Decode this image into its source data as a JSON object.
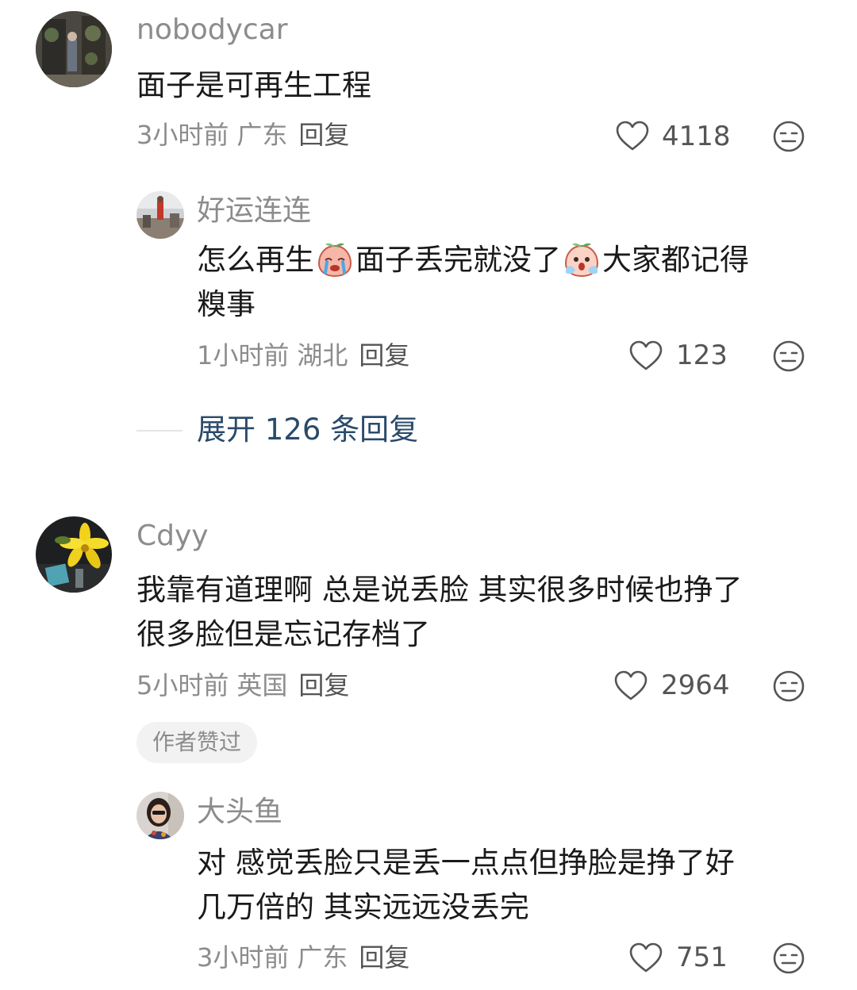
{
  "comments": [
    {
      "username": "nobodycar",
      "text": "面子是可再生工程",
      "time": "3小时前",
      "region": "广东",
      "reply_label": "回复",
      "likes": "4118",
      "replies": [
        {
          "username": "好运连连",
          "text_parts": [
            "怎么再生",
            "面子丢完就没了",
            "大家都记得",
            "糗事"
          ],
          "time": "1小时前",
          "region": "湖北",
          "reply_label": "回复",
          "likes": "123"
        }
      ],
      "expand_label": "展开 126 条回复"
    },
    {
      "username": "Cdyy",
      "text_lines": [
        "我靠有道理啊 总是说丢脸 其实很多时候也挣了",
        "很多脸但是忘记存档了"
      ],
      "time": "5小时前",
      "region": "英国",
      "reply_label": "回复",
      "likes": "2964",
      "badge": "作者赞过",
      "replies": [
        {
          "username": "大头鱼",
          "text_lines": [
            "对 感觉丢脸只是丢一点点但挣脸是挣了好",
            "几万倍的 其实远远没丢完"
          ],
          "time": "3小时前",
          "region": "广东",
          "reply_label": "回复",
          "likes": "751"
        }
      ]
    }
  ],
  "icons": {
    "like": "heart-outline-icon",
    "dislike": "meh-face-icon",
    "emoji_1": "crying-peach-emoji",
    "emoji_2": "scared-peach-emoji"
  },
  "colors": {
    "username": "#8c8c8c",
    "text": "#1a1a1a",
    "expand_link": "#2a4a6b",
    "badge_bg": "#f2f2f2"
  }
}
